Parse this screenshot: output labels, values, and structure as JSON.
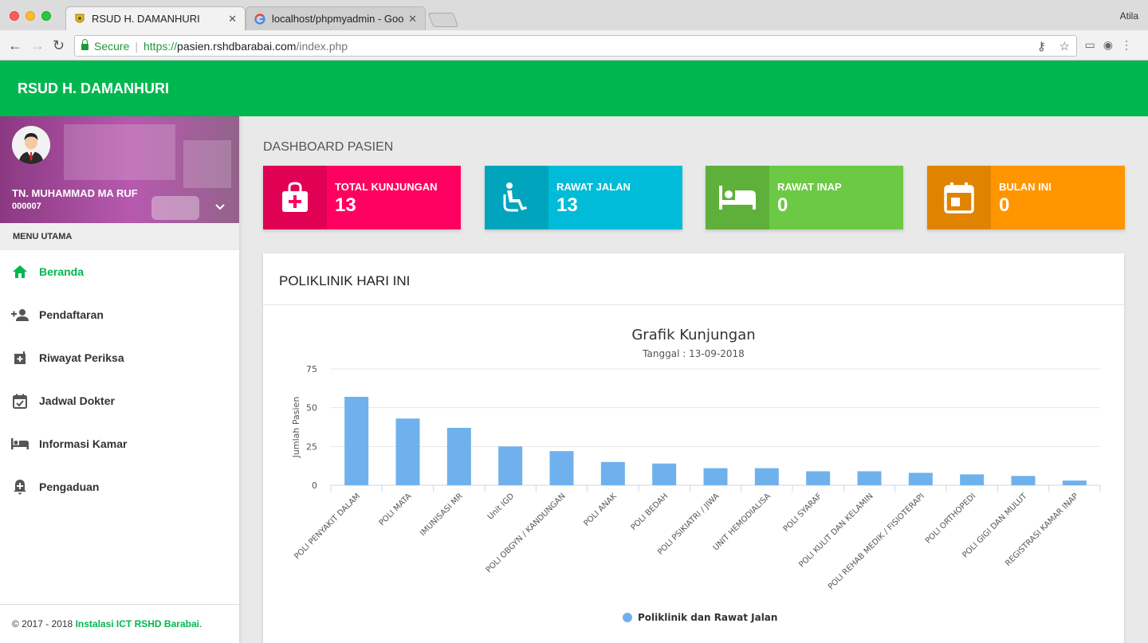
{
  "browser": {
    "tabs": [
      {
        "title": "RSUD H. DAMANHURI",
        "active": true
      },
      {
        "title": "localhost/phpmyadmin - Google",
        "active": false
      }
    ],
    "profile": "Atila",
    "secure_label": "Secure",
    "url_scheme": "https://",
    "url_host": "pasien.rshdbarabai.com",
    "url_path": "/index.php"
  },
  "app": {
    "title": "RSUD H. DAMANHURI",
    "brand_color": "#00b74f"
  },
  "user": {
    "name": "TN. MUHAMMAD MA RUF",
    "id": "000007"
  },
  "sidebar": {
    "menu_header": "MENU UTAMA",
    "items": [
      {
        "label": "Beranda",
        "icon": "home-icon",
        "active": true
      },
      {
        "label": "Pendaftaran",
        "icon": "person-add-icon",
        "active": false
      },
      {
        "label": "Riwayat Periksa",
        "icon": "medical-case-icon",
        "active": false
      },
      {
        "label": "Jadwal Dokter",
        "icon": "calendar-check-icon",
        "active": false
      },
      {
        "label": "Informasi Kamar",
        "icon": "bed-icon",
        "active": false
      },
      {
        "label": "Pengaduan",
        "icon": "alarm-add-icon",
        "active": false
      }
    ],
    "footer_prefix": "© 2017 - 2018 ",
    "footer_link": "Instalasi ICT RSHD Barabai",
    "footer_suffix": "."
  },
  "main": {
    "heading": "DASHBOARD PASIEN",
    "info_boxes": [
      {
        "label": "TOTAL KUNJUNGAN",
        "value": "13",
        "color": "#ff0060",
        "icon": "medical-bag-icon"
      },
      {
        "label": "RAWAT JALAN",
        "value": "13",
        "color": "#00bcd8",
        "icon": "wheelchair-icon"
      },
      {
        "label": "RAWAT INAP",
        "value": "0",
        "color": "#6cc944",
        "icon": "hotel-bed-icon"
      },
      {
        "label": "BULAN INI",
        "value": "0",
        "color": "#ff9600",
        "icon": "calendar-icon"
      }
    ],
    "card_title": "POLIKLINIK HARI INI"
  },
  "chart_data": {
    "type": "bar",
    "title": "Grafik Kunjungan",
    "subtitle": "Tanggal : 13-09-2018",
    "xlabel": "",
    "ylabel": "Jumlah Pasien",
    "ylim": [
      0,
      75
    ],
    "yticks": [
      0,
      25,
      50,
      75
    ],
    "grid": true,
    "legend_position": "bottom",
    "bar_color": "#6fb1ec",
    "categories": [
      "POLI PENYAKIT DALAM",
      "POLI MATA",
      "IMUNISASI MR",
      "Unit IGD",
      "POLI OBGYN / KANDUNGAN",
      "POLI ANAK",
      "POLI BEDAH",
      "POLI PSIKIATRI / JIWA",
      "UNIT HEMODIALISA",
      "POLI SYARAF",
      "POLI KULIT DAN KELAMIN",
      "POLI REHAB MEDIK / FISIOTERAPI",
      "POLI ORTHOPEDI",
      "POLI GIGI DAN MULUT",
      "REGISTRASI KAMAR INAP"
    ],
    "series": [
      {
        "name": "Poliklinik dan Rawat Jalan",
        "values": [
          57,
          43,
          37,
          25,
          22,
          15,
          14,
          11,
          11,
          9,
          9,
          8,
          7,
          6,
          3
        ]
      }
    ]
  }
}
